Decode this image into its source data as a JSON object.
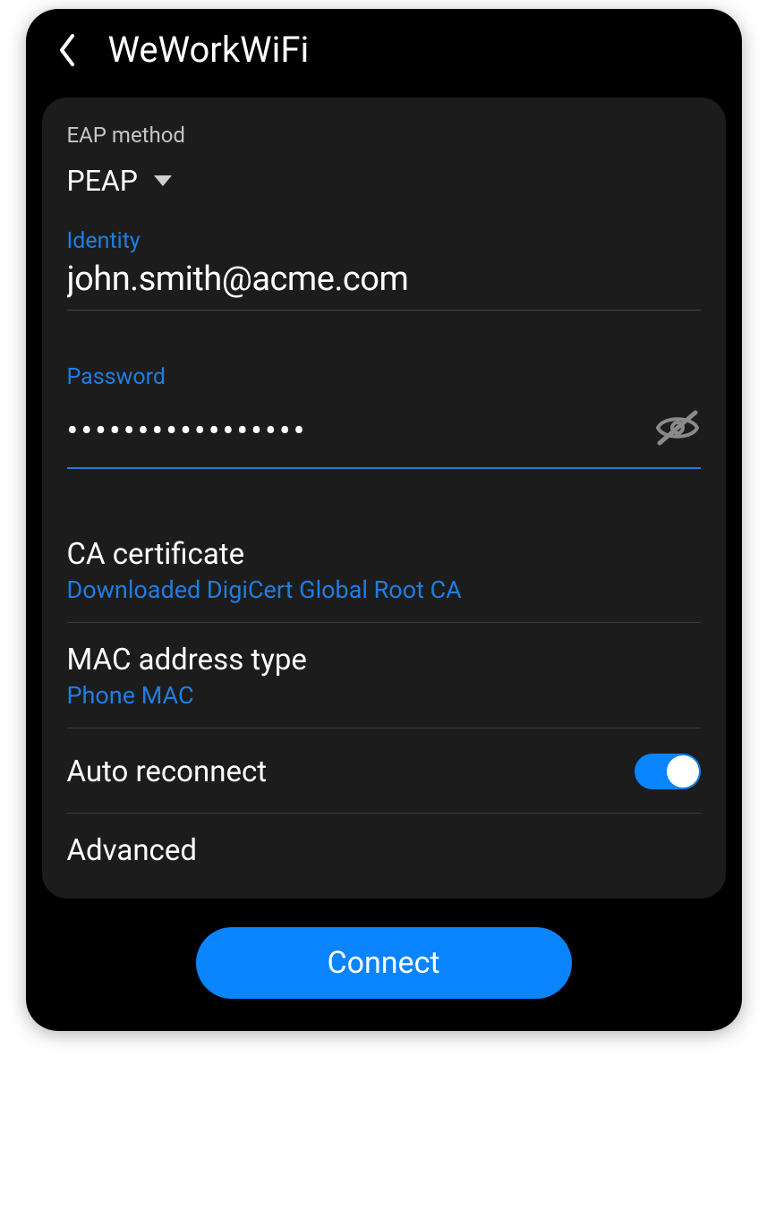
{
  "header": {
    "title": "WeWorkWiFi"
  },
  "eap": {
    "label": "EAP method",
    "value": "PEAP"
  },
  "identity": {
    "label": "Identity",
    "value": "john.smith@acme.com"
  },
  "password": {
    "label": "Password",
    "mask": "•••••••••••••••••"
  },
  "rows": {
    "ca_cert": {
      "title": "CA certificate",
      "value": "Downloaded DigiCert Global Root CA"
    },
    "mac_type": {
      "title": "MAC address type",
      "value": "Phone MAC"
    },
    "auto_reconnect": {
      "title": "Auto reconnect",
      "enabled": true
    },
    "advanced": {
      "title": "Advanced"
    }
  },
  "actions": {
    "connect": "Connect"
  }
}
